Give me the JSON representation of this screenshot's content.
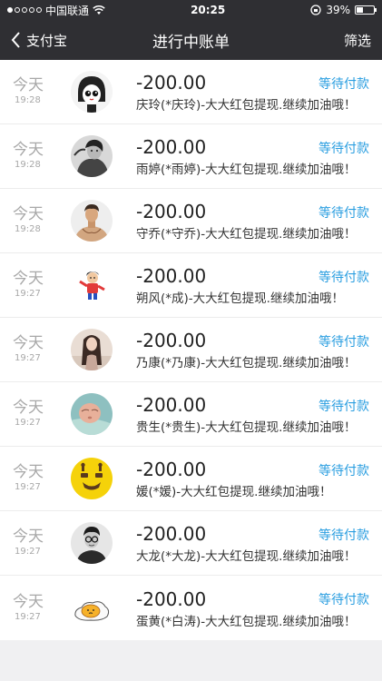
{
  "status_bar": {
    "carrier": "中国联通",
    "time": "20:25",
    "battery": "39%",
    "battery_level": 0.39
  },
  "nav": {
    "back_label": "支付宝",
    "title": "进行中账单",
    "filter_label": "筛选"
  },
  "bills": [
    {
      "day": "今天",
      "time": "19:28",
      "amount": "-200.00",
      "desc": "庆玲(*庆玲)-大大红包提现.继续加油哦！",
      "status": "等待付款",
      "avatar": "girl-cartoon-avatar"
    },
    {
      "day": "今天",
      "time": "19:28",
      "amount": "-200.00",
      "desc": "雨婷(*雨婷)-大大红包提现.继续加油哦！",
      "status": "等待付款",
      "avatar": "woman-bw-avatar"
    },
    {
      "day": "今天",
      "time": "19:28",
      "amount": "-200.00",
      "desc": "守乔(*守乔)-大大红包提现.继续加油哦！",
      "status": "等待付款",
      "avatar": "man-avatar"
    },
    {
      "day": "今天",
      "time": "19:27",
      "amount": "-200.00",
      "desc": "朔风(*成)-大大红包提现.继续加油哦！",
      "status": "等待付款",
      "avatar": "cartoon-figure-avatar"
    },
    {
      "day": "今天",
      "time": "19:27",
      "amount": "-200.00",
      "desc": "乃康(*乃康)-大大红包提现.继续加油哦！",
      "status": "等待付款",
      "avatar": "long-hair-avatar"
    },
    {
      "day": "今天",
      "time": "19:27",
      "amount": "-200.00",
      "desc": "贵生(*贵生)-大大红包提现.继续加油哦！",
      "status": "等待付款",
      "avatar": "baby-avatar"
    },
    {
      "day": "今天",
      "time": "19:27",
      "amount": "-200.00",
      "desc": "媛(*媛)-大大红包提现.继续加油哦！",
      "status": "等待付款",
      "avatar": "giraffe-avatar"
    },
    {
      "day": "今天",
      "time": "19:27",
      "amount": "-200.00",
      "desc": "大龙(*大龙)-大大红包提现.继续加油哦！",
      "status": "等待付款",
      "avatar": "man-glasses-avatar"
    },
    {
      "day": "今天",
      "time": "19:27",
      "amount": "-200.00",
      "desc": "蛋黄(*白涛)-大大红包提现.继续加油哦！",
      "status": "等待付款",
      "avatar": "egg-yolk-avatar"
    }
  ],
  "colors": {
    "header_bg": "#2f2f33",
    "status_blue": "#2a9ee0",
    "muted_gray": "#a8a8a8"
  }
}
